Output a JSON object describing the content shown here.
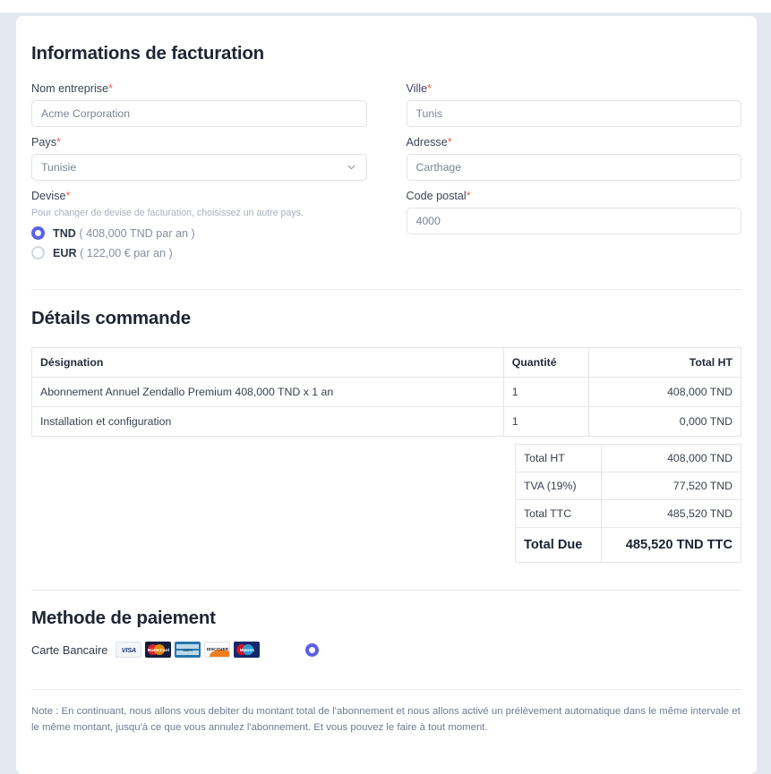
{
  "billing": {
    "title": "Informations de facturation",
    "fields": {
      "company": {
        "label": "Nom entreprise",
        "required": "*",
        "value": "Acme Corporation"
      },
      "city": {
        "label": "Ville",
        "required": "*",
        "value": "Tunis"
      },
      "country": {
        "label": "Pays",
        "required": "*",
        "value": "Tunisie",
        "icon": "chevron-down-icon"
      },
      "address": {
        "label": "Adresse",
        "required": "*",
        "value": "Carthage"
      },
      "currency": {
        "label": "Devise",
        "required": "*",
        "help": "Pour changer de devise de facturation, choisissez un autre pays."
      },
      "postal": {
        "label": "Code postal",
        "required": "*",
        "value": "4000"
      }
    },
    "currency_options": [
      {
        "code": "TND",
        "detail": "( 408,000 TND par an )",
        "selected": true
      },
      {
        "code": "EUR",
        "detail": "( 122,00 € par an )",
        "selected": false
      }
    ]
  },
  "order": {
    "title": "Détails commande",
    "columns": [
      "Désignation",
      "Quantité",
      "Total HT"
    ],
    "rows": [
      {
        "designation": "Abonnement Annuel Zendallo Premium 408,000 TND x 1 an",
        "qty": "1",
        "total": "408,000 TND"
      },
      {
        "designation": "Installation et configuration",
        "qty": "1",
        "total": "0,000 TND"
      }
    ],
    "totals": [
      {
        "label": "Total HT",
        "value": "408,000 TND",
        "grand": false
      },
      {
        "label": "TVA (19%)",
        "value": "77,520 TND",
        "grand": false
      },
      {
        "label": "Total TTC",
        "value": "485,520 TND",
        "grand": false
      },
      {
        "label": "Total Due",
        "value": "485,520 TND TTC",
        "grand": true
      }
    ]
  },
  "payment": {
    "title": "Methode de paiement",
    "method_label": "Carte Bancaire",
    "cards": [
      {
        "name": "visa-card-icon",
        "text": "VISA"
      },
      {
        "name": "mastercard-card-icon",
        "text": "MasterCard"
      },
      {
        "name": "amex-card-icon",
        "text": "AMERICAN EXPRESS"
      },
      {
        "name": "discover-card-icon",
        "text": "DISCOVER"
      },
      {
        "name": "maestro-card-icon",
        "text": "Maestro"
      }
    ],
    "selected": true
  },
  "note": "Note : En continuant, nous allons vous debiter du montant total de l'abonnement et nous allons activé un prélèvement automatique dans le même intervale et le même montant, jusqu'à ce que vous annulez l'abonnement. Et vous pouvez le faire à tout moment.",
  "colors": {
    "accent": "#5b5fe8",
    "required": "#e8603c",
    "page_bg": "#e3e8f0",
    "text": "#2f3746"
  }
}
